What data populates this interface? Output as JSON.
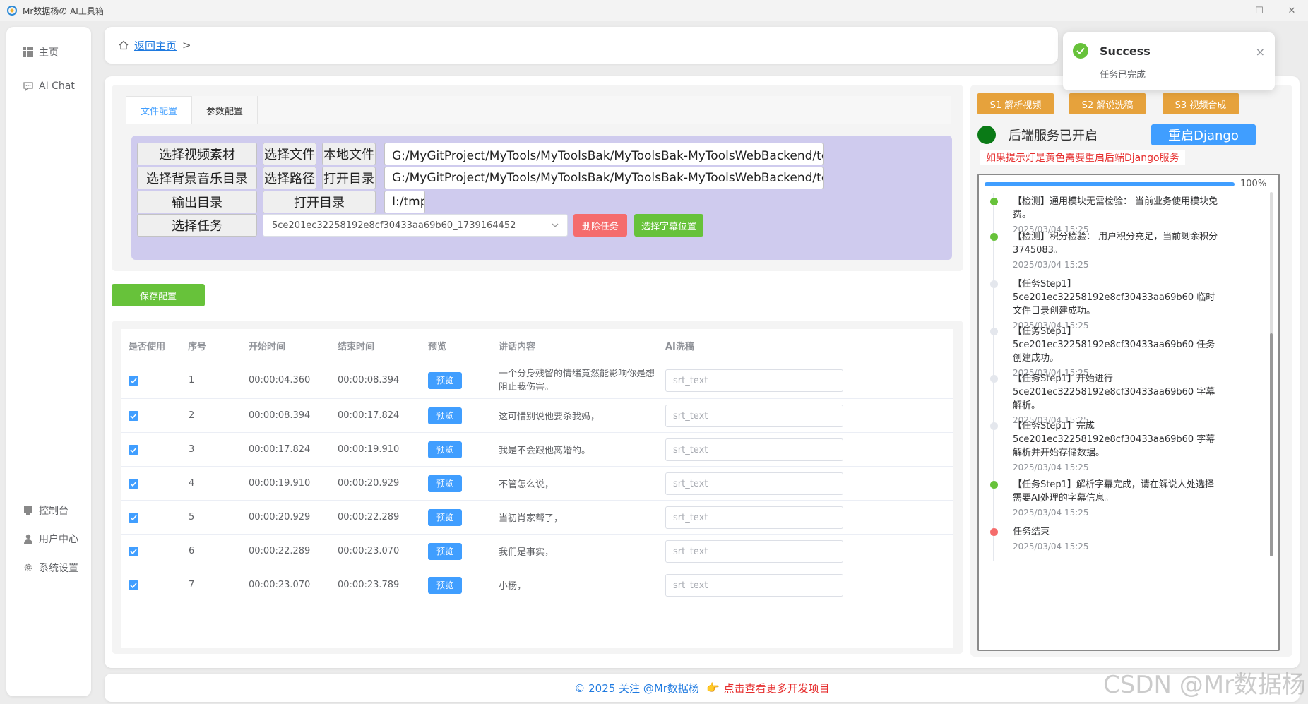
{
  "window": {
    "title": "Mr数据杨の AI工具箱",
    "min": "—",
    "max": "☐",
    "close": "✕"
  },
  "sidebar": {
    "items": [
      {
        "label": "主页",
        "icon": "grid-icon"
      },
      {
        "label": "AI Chat",
        "icon": "chat-icon"
      }
    ],
    "bottom": [
      {
        "label": "控制台",
        "icon": "monitor-icon"
      },
      {
        "label": "用户中心",
        "icon": "user-icon"
      },
      {
        "label": "系统设置",
        "icon": "gear-icon"
      }
    ]
  },
  "breadcrumb": {
    "home": "返回主页",
    "sep": ">"
  },
  "tabs": [
    {
      "label": "文件配置",
      "active": true
    },
    {
      "label": "参数配置",
      "active": false
    }
  ],
  "form": {
    "video_label": "选择视频素材",
    "select_file": "选择文件",
    "local_file": "本地文件",
    "video_path": "G:/MyGitProject/MyTools/MyToolsBak/MyToolsBak-MyToolsWebBackend/temp_from/短...",
    "music_label": "选择背景音乐目录",
    "select_path": "选择路径",
    "open_dir": "打开目录",
    "music_path": "G:/MyGitProject/MyTools/MyToolsBak/MyToolsBak-MyToolsWebBackend/temp_from/m...",
    "output_label": "输出目录",
    "open_dir2": "打开目录",
    "output_path": "I:/tmp",
    "task_label": "选择任务",
    "task_value": "5ce201ec32258192e8cf30433aa69b60_1739164452",
    "delete_task": "删除任务",
    "subtitle_pos": "选择字幕位置"
  },
  "save_button": "保存配置",
  "table": {
    "headers": [
      "是否使用",
      "序号",
      "开始时间",
      "结束时间",
      "预览",
      "讲话内容",
      "AI洗稿"
    ],
    "preview_label": "预览",
    "placeholder": "srt_text",
    "rows": [
      {
        "idx": "1",
        "start": "00:00:04.360",
        "end": "00:00:08.394",
        "text": "一个分身残留的情绪竟然能影响你是想阻止我伤害。"
      },
      {
        "idx": "2",
        "start": "00:00:08.394",
        "end": "00:00:17.824",
        "text": "这可惜别说他要杀我妈，"
      },
      {
        "idx": "3",
        "start": "00:00:17.824",
        "end": "00:00:19.910",
        "text": "我是不会跟他离婚的。"
      },
      {
        "idx": "4",
        "start": "00:00:19.910",
        "end": "00:00:20.929",
        "text": "不管怎么说，"
      },
      {
        "idx": "5",
        "start": "00:00:20.929",
        "end": "00:00:22.289",
        "text": "当初肖家帮了，"
      },
      {
        "idx": "6",
        "start": "00:00:22.289",
        "end": "00:00:23.070",
        "text": "我们是事实，"
      },
      {
        "idx": "7",
        "start": "00:00:23.070",
        "end": "00:00:23.789",
        "text": "小杨，"
      }
    ]
  },
  "steps": [
    "S1 解析视频",
    "S2 解说洗稿",
    "S3 视频合成"
  ],
  "backend": {
    "status": "后端服务已开启",
    "restart": "重启Django",
    "warning": "如果提示灯是黄色需要重启后端Django服务",
    "indicator_color": "#0a7a16"
  },
  "log": {
    "progress": "100%",
    "progress_value": 1.0,
    "entries": [
      {
        "text": "【检测】通用模块无需检验： 当前业务使用模块免费。",
        "time": "2025/03/04 15:25",
        "color": "#67c23a"
      },
      {
        "text": "【检测】积分检验： 用户积分充足，当前剩余积分 3745083。",
        "time": "2025/03/04 15:25",
        "color": "#67c23a"
      },
      {
        "text": "【任务Step1】 5ce201ec32258192e8cf30433aa69b60 临时文件目录创建成功。",
        "time": "2025/03/04 15:25",
        "color": "#e4e7ed"
      },
      {
        "text": "【任务Step1】 5ce201ec32258192e8cf30433aa69b60 任务创建成功。",
        "time": "2025/03/04 15:25",
        "color": "#e4e7ed"
      },
      {
        "text": "【任务Step1】开始进行 5ce201ec32258192e8cf30433aa69b60 字幕解析。",
        "time": "2025/03/04 15:25",
        "color": "#e4e7ed"
      },
      {
        "text": "【任务Step1】完成 5ce201ec32258192e8cf30433aa69b60 字幕解析并开始存储数据。",
        "time": "2025/03/04 15:25",
        "color": "#e4e7ed"
      },
      {
        "text": "【任务Step1】解析字幕完成，请在解说人处选择需要AI处理的字幕信息。",
        "time": "2025/03/04 15:25",
        "color": "#67c23a"
      },
      {
        "text": "任务结束",
        "time": "2025/03/04 15:25",
        "color": "#f56c6c"
      }
    ]
  },
  "footer": {
    "left": "© 2025 关注 @Mr数据杨",
    "emoji": "👉",
    "right": "点击查看更多开发项目"
  },
  "toast": {
    "title": "Success",
    "message": "任务已完成",
    "close": "×"
  },
  "watermark": "CSDN @Mr数据杨"
}
